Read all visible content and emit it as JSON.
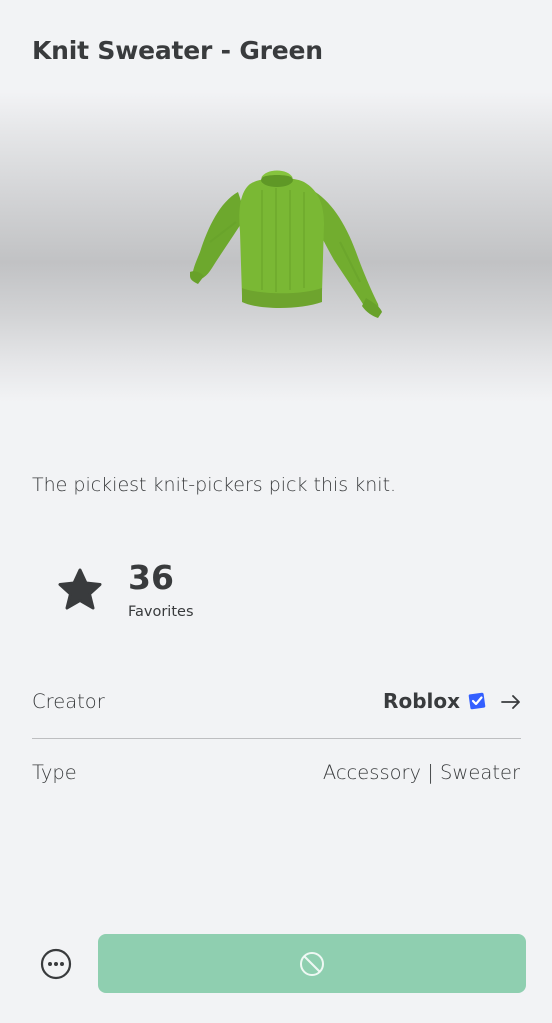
{
  "item": {
    "title": "Knit Sweater - Green",
    "description": "The pickiest knit-pickers pick this knit.",
    "favorites_count": "36",
    "favorites_label": "Favorites"
  },
  "details": {
    "creator_label": "Creator",
    "creator_name": "Roblox",
    "type_label": "Type",
    "type_value": "Accessory | Sweater"
  },
  "icons": {
    "favorite": "star-icon",
    "verified": "verified-badge-icon",
    "navigate": "arrow-right-icon",
    "more": "more-options-icon",
    "unavailable": "prohibited-icon"
  },
  "colors": {
    "background": "#f2f3f5",
    "text": "#393b3d",
    "buy_button": "#8fcfb0",
    "sweater": "#7ab834",
    "verified": "#335fff"
  }
}
